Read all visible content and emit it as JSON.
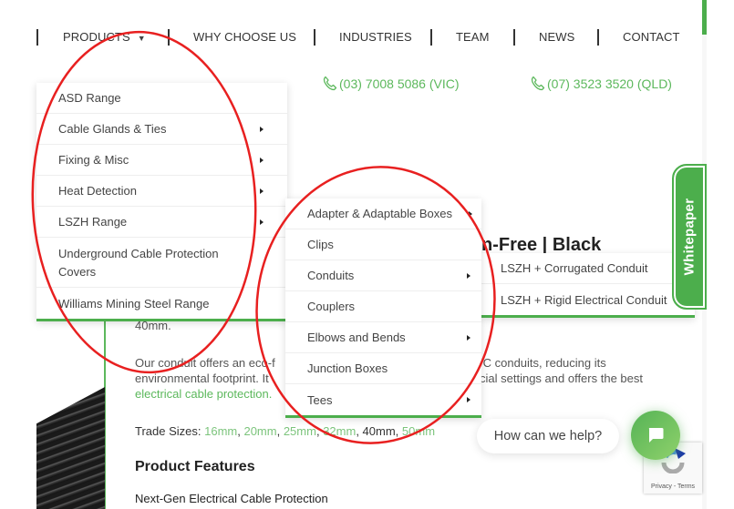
{
  "nav": {
    "items": [
      {
        "label": "PRODUCTS",
        "has_caret": true
      },
      {
        "label": "WHY CHOOSE US"
      },
      {
        "label": "INDUSTRIES"
      },
      {
        "label": "TEAM"
      },
      {
        "label": "NEWS"
      },
      {
        "label": "CONTACT"
      }
    ],
    "caret_glyph": "▼"
  },
  "phones": [
    {
      "icon": "phone-icon",
      "label": "(03) 7008 5086 (VIC)"
    },
    {
      "icon": "phone-icon",
      "label": "(07) 3523 3520 (QLD)"
    }
  ],
  "products_menu": {
    "items": [
      {
        "label": "ASD Range",
        "has_submenu": false
      },
      {
        "label": "Cable Glands & Ties",
        "has_submenu": true
      },
      {
        "label": "Fixing & Misc",
        "has_submenu": true
      },
      {
        "label": "Heat Detection",
        "has_submenu": true
      },
      {
        "label": "LSZH Range",
        "has_submenu": true
      },
      {
        "label": "Underground Cable Protection Covers",
        "has_submenu": false
      },
      {
        "label": "Williams Mining Steel Range",
        "has_submenu": false
      }
    ]
  },
  "lszh_submenu": {
    "items": [
      {
        "label": "Adapter & Adaptable Boxes",
        "has_submenu": true
      },
      {
        "label": "Clips",
        "has_submenu": false
      },
      {
        "label": "Conduits",
        "has_submenu": true
      },
      {
        "label": "Couplers",
        "has_submenu": false
      },
      {
        "label": "Elbows and Bends",
        "has_submenu": true
      },
      {
        "label": "Junction Boxes",
        "has_submenu": false
      },
      {
        "label": "Tees",
        "has_submenu": true
      }
    ]
  },
  "conduits_submenu": {
    "items": [
      {
        "label": "LSZH + Corrugated Conduit"
      },
      {
        "label": "LSZH + Rigid Electrical Conduit"
      }
    ]
  },
  "content": {
    "title_fragment": "n-Free | Black",
    "size_line": "40mm.",
    "para_line1_left": "Our conduit offers an eco-f",
    "para_line1_right": "/C conduits, reducing its",
    "para_line2_left": "environmental footprint. It",
    "para_line2_right": "cial settings and offers the best",
    "para_line3_link": "electrical cable protection",
    "para_line3_end": ".",
    "trade_label": "Trade Sizes: ",
    "trade_sizes": [
      {
        "label": "16mm",
        "linked": true
      },
      {
        "label": "20mm",
        "linked": true
      },
      {
        "label": "25mm",
        "linked": true
      },
      {
        "label": "32mm",
        "linked": true
      },
      {
        "label": "40mm",
        "linked": false
      },
      {
        "label": "50mm",
        "linked": true
      }
    ],
    "features_heading": "Product Features",
    "feature_1": "Next-Gen Electrical Cable Protection"
  },
  "whitepaper_tab": {
    "label": "Whitepaper"
  },
  "chat": {
    "prompt": "How can we help?",
    "icon": "chat-icon"
  },
  "recaptcha": {
    "text": "Privacy - Terms"
  },
  "colors": {
    "brand_green": "#4cae4c",
    "link_green": "#5cb85c",
    "annotation_red": "#e82020"
  }
}
